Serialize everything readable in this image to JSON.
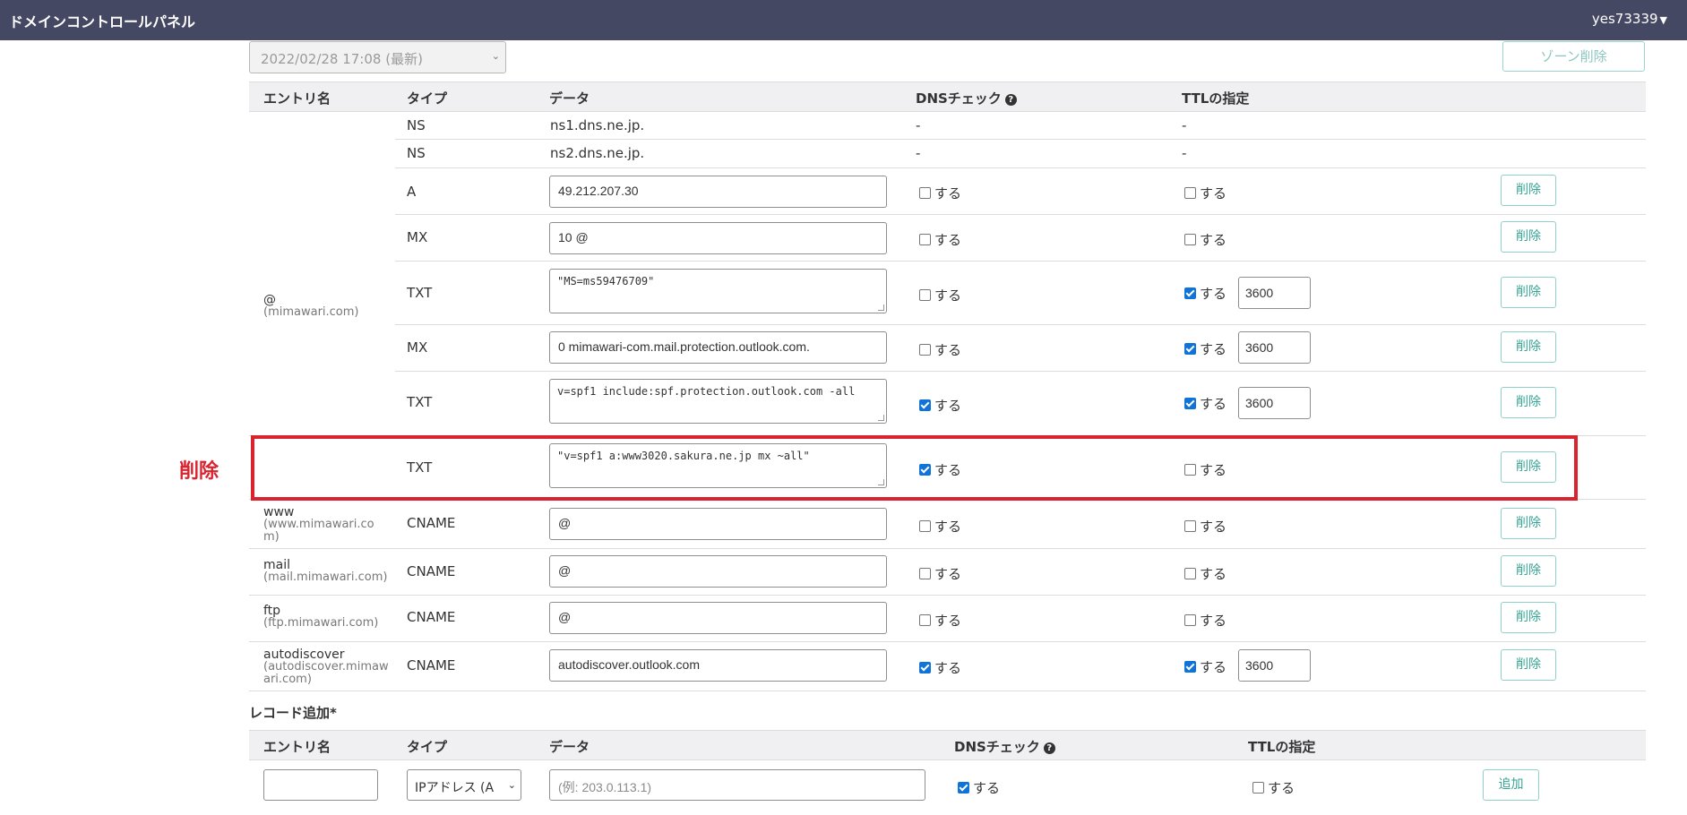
{
  "header": {
    "title": "ドメインコントロールパネル",
    "user": "yes73339"
  },
  "zone": {
    "selected_version": "2022/02/28 17:08 (最新)",
    "delete_label": "ゾーン削除"
  },
  "table_headers": {
    "entry": "エントリ名",
    "type": "タイプ",
    "data": "データ",
    "dns_check": "DNSチェック",
    "ttl": "TTLの指定"
  },
  "check_label": "する",
  "delete_label": "削除",
  "dash": "-",
  "root_entry": {
    "name": "@",
    "sub": "(mimawari.com)"
  },
  "records": [
    {
      "type": "NS",
      "data": "ns1.dns.ne.jp."
    },
    {
      "type": "NS",
      "data": "ns2.dns.ne.jp."
    },
    {
      "type": "A",
      "data": "49.212.207.30",
      "dns_check": false,
      "ttl_checked": false
    },
    {
      "type": "MX",
      "data": "10 @",
      "dns_check": false,
      "ttl_checked": false
    },
    {
      "type": "TXT",
      "data": "\"MS=ms59476709\"",
      "dns_check": false,
      "ttl_checked": true,
      "ttl": "3600"
    },
    {
      "type": "MX",
      "data": "0 mimawari-com.mail.protection.outlook.com.",
      "dns_check": false,
      "ttl_checked": true,
      "ttl": "3600"
    },
    {
      "type": "TXT",
      "data": "v=spf1 include:spf.protection.outlook.com -all",
      "dns_check": true,
      "ttl_checked": true,
      "ttl": "3600"
    },
    {
      "type": "TXT",
      "data": "\"v=spf1 a:www3020.sakura.ne.jp mx ~all\"",
      "dns_check": true,
      "ttl_checked": false
    },
    {
      "entry": "www",
      "entry_sub_1": "(www.mimawari.co",
      "entry_sub_2": "m)",
      "type": "CNAME",
      "data": "@",
      "dns_check": false,
      "ttl_checked": false
    },
    {
      "entry": "mail",
      "entry_sub_1": "(mail.mimawari.com)",
      "type": "CNAME",
      "data": "@",
      "dns_check": false,
      "ttl_checked": false
    },
    {
      "entry": "ftp",
      "entry_sub_1": "(ftp.mimawari.com)",
      "type": "CNAME",
      "data": "@",
      "dns_check": false,
      "ttl_checked": false
    },
    {
      "entry": "autodiscover",
      "entry_sub_1": "(autodiscover.mimaw",
      "entry_sub_2": "ari.com)",
      "type": "CNAME",
      "data": "autodiscover.outlook.com",
      "dns_check": true,
      "ttl_checked": true,
      "ttl": "3600"
    }
  ],
  "annotation": {
    "label": "削除",
    "color": "#d9232e"
  },
  "add_record": {
    "title": "レコード追加*",
    "type_selected": "IPアドレス (A",
    "data_placeholder": "(例: 203.0.113.1)",
    "dns_check": true,
    "ttl_checked": false,
    "add_label": "追加"
  },
  "colors": {
    "topbar": "#454862",
    "accent": "#36a595",
    "checkbox": "#0f73d8"
  }
}
